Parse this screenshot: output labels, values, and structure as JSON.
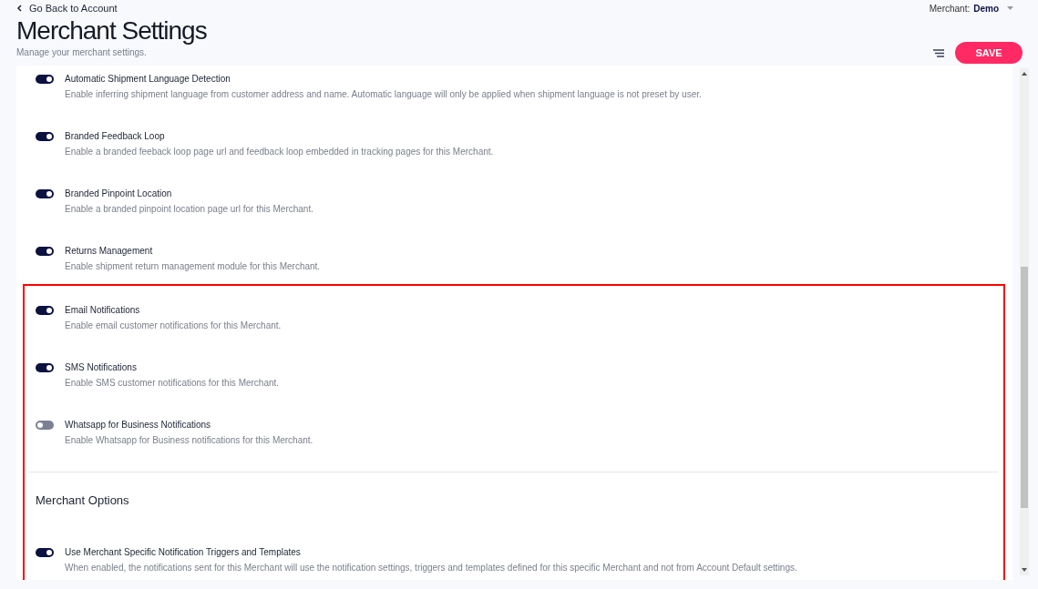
{
  "header": {
    "back_link": "Go Back to Account",
    "title": "Merchant Settings",
    "subtitle": "Manage your merchant settings.",
    "merchant_label": "Merchant:",
    "merchant_value": "Demo",
    "save_button": "SAVE"
  },
  "groups": [
    {
      "highlighted": false,
      "items": [
        {
          "kind": "toggle",
          "title": "Automatic Shipment Language Detection",
          "description": "Enable inferring shipment language from customer address and name. Automatic language will only be applied when shipment language is not preset by user.",
          "on": true
        },
        {
          "kind": "toggle",
          "title": "Branded Feedback Loop",
          "description": "Enable a branded feeback loop page url and feedback loop embedded in tracking pages for this Merchant.",
          "on": true
        },
        {
          "kind": "toggle",
          "title": "Branded Pinpoint Location",
          "description": "Enable a branded pinpoint location page url for this Merchant.",
          "on": true
        },
        {
          "kind": "toggle",
          "title": "Returns Management",
          "description": "Enable shipment return management module for this Merchant.",
          "on": true
        }
      ]
    },
    {
      "highlighted": true,
      "items": [
        {
          "kind": "toggle",
          "title": "Email Notifications",
          "description": "Enable email customer notifications for this Merchant.",
          "on": true
        },
        {
          "kind": "toggle",
          "title": "SMS Notifications",
          "description": "Enable SMS customer notifications for this Merchant.",
          "on": true
        },
        {
          "kind": "toggle",
          "title": "Whatsapp for Business Notifications",
          "description": "Enable Whatsapp for Business notifications for this Merchant.",
          "on": false
        },
        {
          "kind": "heading",
          "title": "Merchant Options"
        },
        {
          "kind": "toggle",
          "title": "Use Merchant Specific Notification Triggers and Templates",
          "description": "When enabled, the notifications sent for this Merchant will use the notification settings, triggers and templates defined for this specific Merchant and not from Account Default settings.",
          "on": true
        }
      ]
    }
  ]
}
